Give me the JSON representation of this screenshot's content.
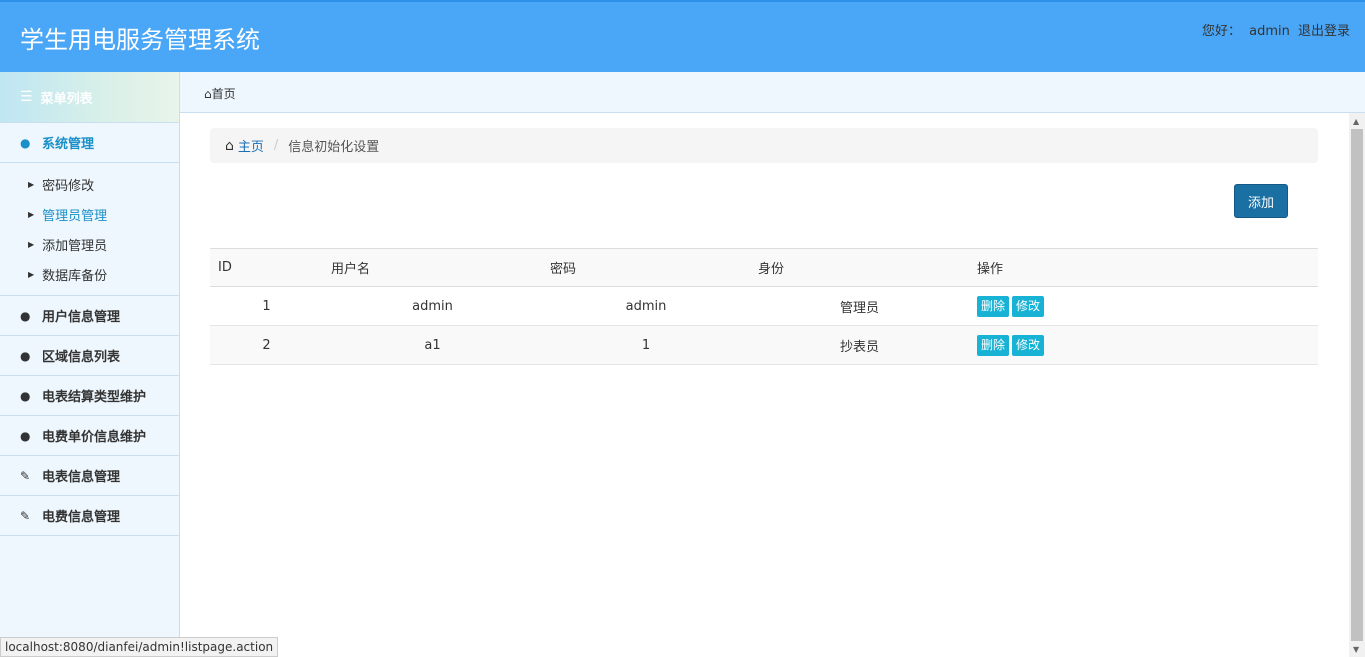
{
  "header": {
    "app_title": "学生用电服务管理系统",
    "greeting": "您好：",
    "username": "admin",
    "logout": "退出登录"
  },
  "sidebar": {
    "menu_title": "菜单列表",
    "groups": [
      {
        "label": "系统管理",
        "icon": "user-icon"
      },
      {
        "label": "用户信息管理",
        "icon": "user-icon"
      },
      {
        "label": "区域信息列表",
        "icon": "user-icon"
      },
      {
        "label": "电表结算类型维护",
        "icon": "user-icon"
      },
      {
        "label": "电费单价信息维护",
        "icon": "user-icon"
      },
      {
        "label": "电表信息管理",
        "icon": "edit-icon"
      },
      {
        "label": "电费信息管理",
        "icon": "edit-icon"
      }
    ],
    "sub_items": [
      {
        "label": "密码修改"
      },
      {
        "label": "管理员管理"
      },
      {
        "label": "添加管理员"
      },
      {
        "label": "数据库备份"
      }
    ]
  },
  "tabbar": {
    "home_label": "首页"
  },
  "breadcrumb": {
    "home": "主页",
    "current": "信息初始化设置"
  },
  "toolbar": {
    "add_label": "添加"
  },
  "table": {
    "headers": [
      "ID",
      "用户名",
      "密码",
      "身份",
      "操作"
    ],
    "rows": [
      {
        "id": "1",
        "username": "admin",
        "password": "admin",
        "role": "管理员",
        "delete": "删除",
        "edit": "修改"
      },
      {
        "id": "2",
        "username": "a1",
        "password": "1",
        "role": "抄表员",
        "delete": "删除",
        "edit": "修改"
      }
    ]
  },
  "statusbar": {
    "url": "localhost:8080/dianfei/admin!listpage.action"
  },
  "colors": {
    "header_bg": "#4aa6f6",
    "accent": "#1a8fc9",
    "add_button": "#1a6fa3",
    "op_button": "#17b2d4"
  }
}
